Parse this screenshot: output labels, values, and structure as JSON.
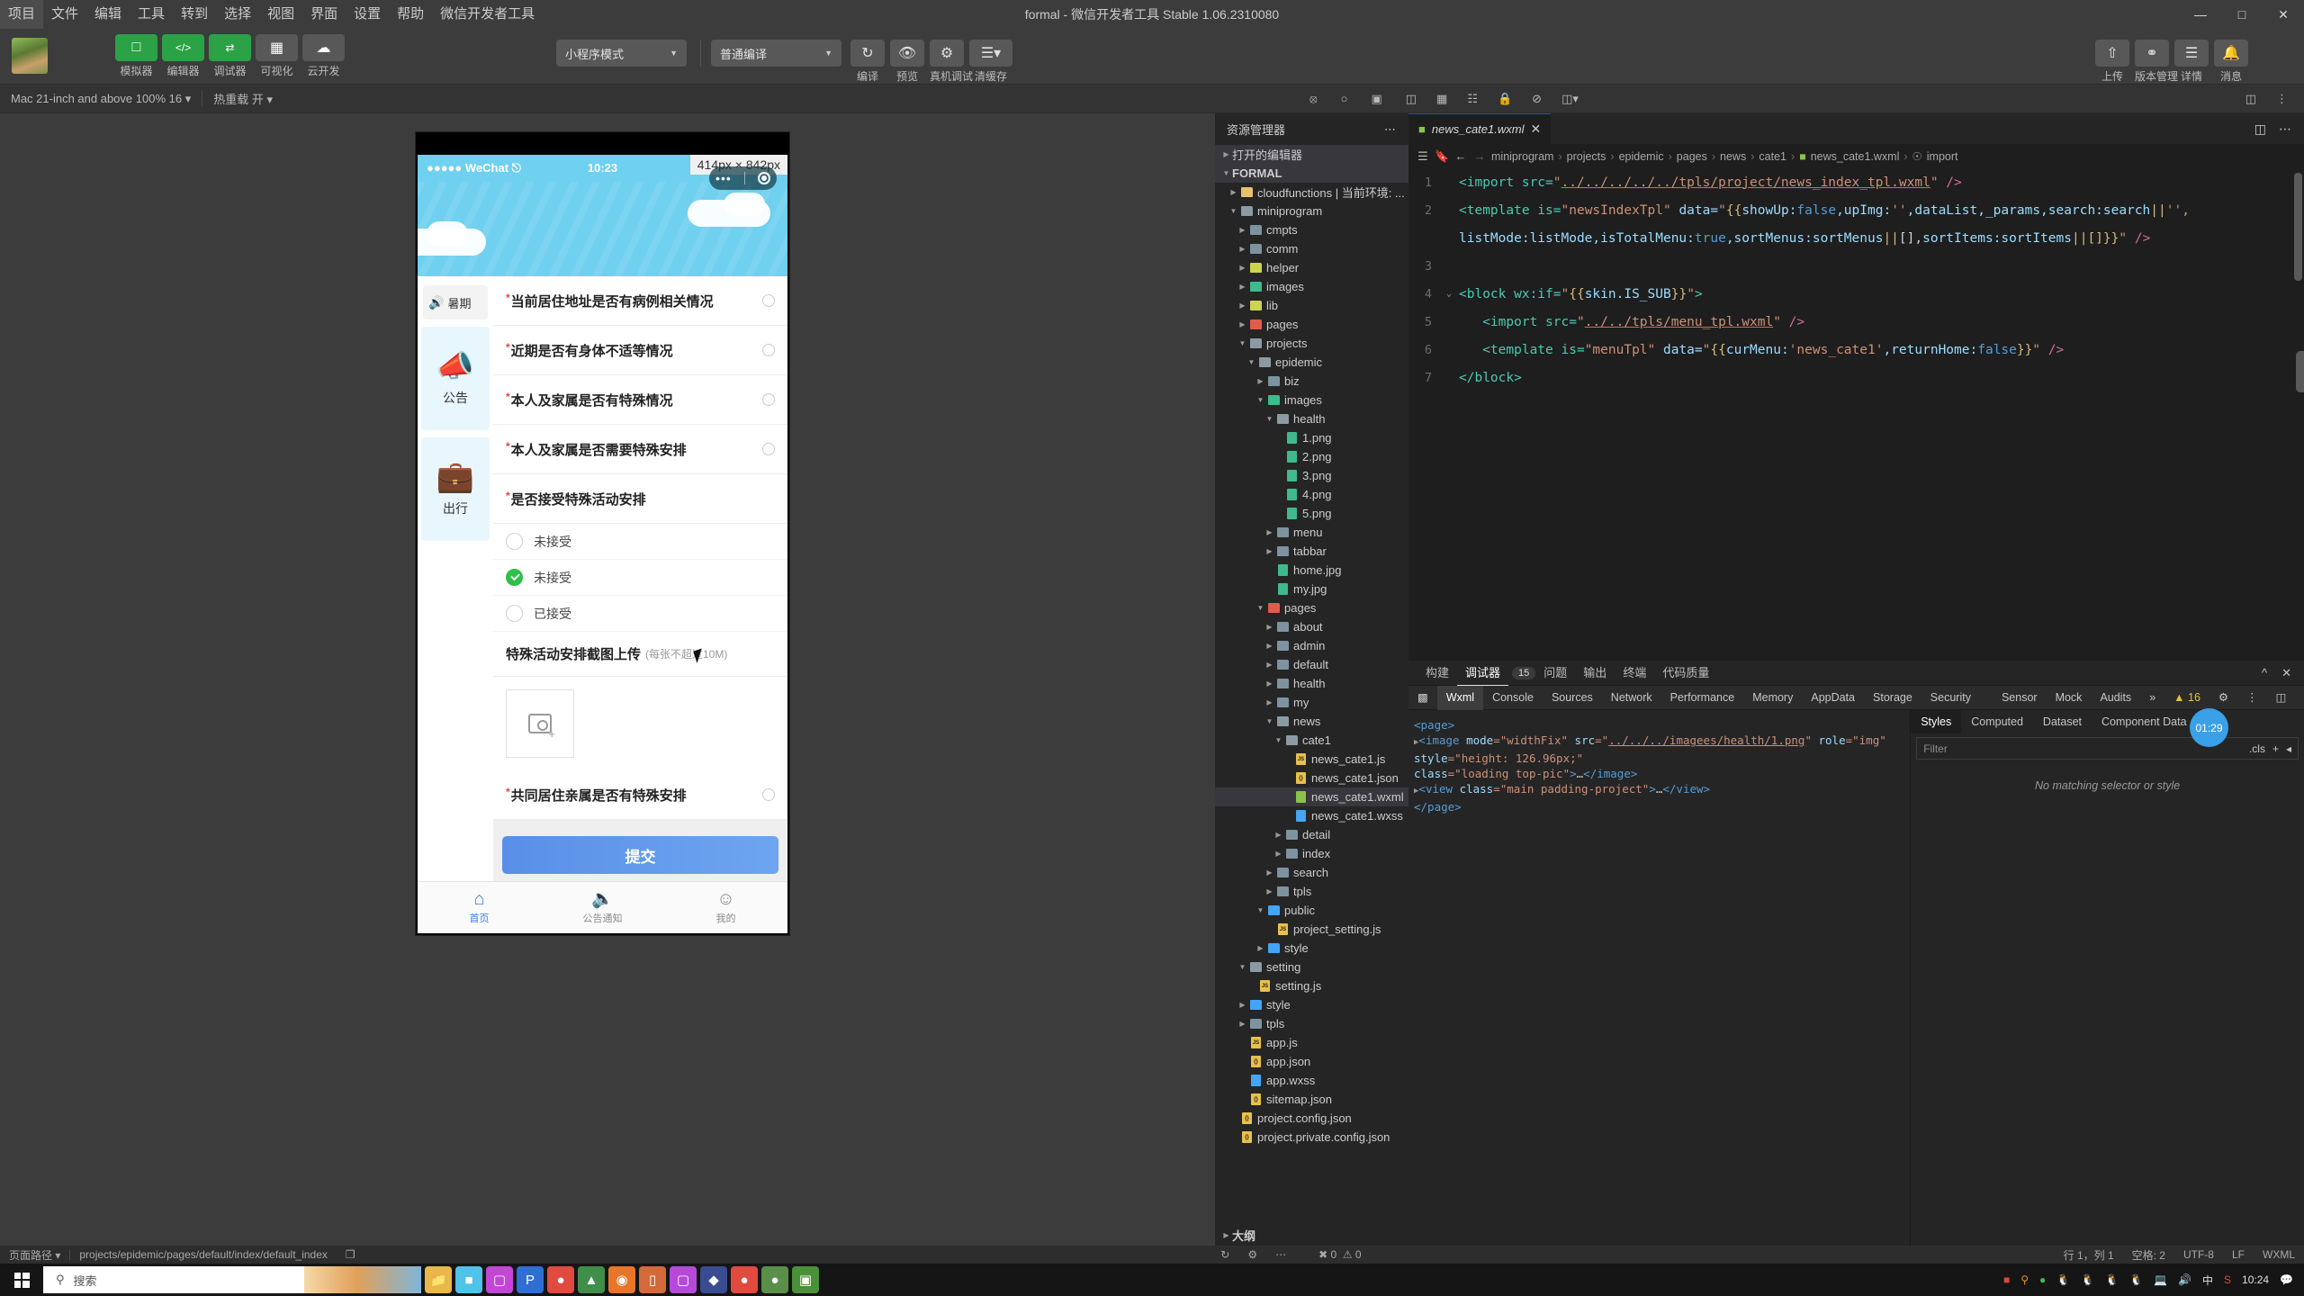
{
  "window": {
    "title": "formal - 微信开发者工具 Stable 1.06.2310080"
  },
  "menubar": {
    "items": [
      "项目",
      "文件",
      "编辑",
      "工具",
      "转到",
      "选择",
      "视图",
      "界面",
      "设置",
      "帮助",
      "微信开发者工具"
    ]
  },
  "toolbar": {
    "mode_buttons": [
      {
        "label": "模拟器",
        "icon": "phone-icon",
        "style": "green"
      },
      {
        "label": "编辑器",
        "icon": "code-icon",
        "style": "green"
      },
      {
        "label": "调试器",
        "icon": "debug-icon",
        "style": "green"
      },
      {
        "label": "可视化",
        "icon": "layout-icon",
        "style": "grey"
      },
      {
        "label": "云开发",
        "icon": "cloud-icon",
        "style": "grey"
      }
    ],
    "mode_select": "小程序模式",
    "compile_select": "普通编译",
    "actions": [
      {
        "label": "编译",
        "icon": "refresh-icon"
      },
      {
        "label": "预览",
        "icon": "eye-icon"
      },
      {
        "label": "真机调试",
        "icon": "bug-icon"
      },
      {
        "label": "清缓存",
        "icon": "layers-icon"
      }
    ],
    "right_actions": [
      {
        "label": "上传",
        "icon": "upload-icon"
      },
      {
        "label": "版本管理",
        "icon": "branch-icon"
      },
      {
        "label": "详情",
        "icon": "menu-icon"
      },
      {
        "label": "消息",
        "icon": "bell-icon"
      }
    ]
  },
  "subbar": {
    "device": "Mac 21-inch and above 100% 16",
    "hotreload": "热重载 开"
  },
  "simulator": {
    "status": {
      "carrier": "WeChat",
      "signal_dots": "●●●●●",
      "wifi": "⇡",
      "time": "10:23"
    },
    "size_chip": "414px × 842px",
    "notice": "暑期",
    "left_cards": [
      {
        "icon": "megaphone-icon",
        "label": "公告"
      },
      {
        "icon": "suitcase-icon",
        "label": "出行"
      }
    ],
    "form_rows": [
      {
        "required": true,
        "label": "当前居住地址是否有病例相关情况"
      },
      {
        "required": true,
        "label": "近期是否有身体不适等情况"
      },
      {
        "required": true,
        "label": "本人及家属是否有特殊情况"
      },
      {
        "required": true,
        "label": "本人及家属是否需要特殊安排"
      },
      {
        "required": true,
        "label": "是否接受特殊活动安排"
      }
    ],
    "options": [
      {
        "label": "未接受",
        "selected": false
      },
      {
        "label": "未接受",
        "selected": true
      },
      {
        "label": "已接受",
        "selected": false
      }
    ],
    "upload": {
      "title": "特殊活动安排截图上传",
      "hint": "(每张不超过10M)",
      "icon": "camera-add-icon"
    },
    "last_row": {
      "required": true,
      "label": "共同居住亲属是否有特殊安排"
    },
    "submit": "提交",
    "tabbar": [
      {
        "label": "首页",
        "icon": "home-icon",
        "active": true
      },
      {
        "label": "公告通知",
        "icon": "speaker-icon",
        "active": false
      },
      {
        "label": "我的",
        "icon": "face-icon",
        "active": false
      }
    ]
  },
  "explorer": {
    "title": "资源管理器",
    "open_editors": "打开的编辑器",
    "root": "FORMAL",
    "tree": [
      {
        "label": "cloudfunctions | 当前环境: ...",
        "indent": 1,
        "type": "folder",
        "color": "#e8c170",
        "arrow": "right"
      },
      {
        "label": "miniprogram",
        "indent": 1,
        "type": "folder",
        "color": "#8a9ba3",
        "arrow": "down"
      },
      {
        "label": "cmpts",
        "indent": 2,
        "type": "folder",
        "color": "#7e93a0",
        "arrow": "right"
      },
      {
        "label": "comm",
        "indent": 2,
        "type": "folder",
        "color": "#7e93a0",
        "arrow": "right"
      },
      {
        "label": "helper",
        "indent": 2,
        "type": "folder",
        "color": "#cdd44f",
        "arrow": "right"
      },
      {
        "label": "images",
        "indent": 2,
        "type": "folder",
        "color": "#3fba8c",
        "arrow": "right"
      },
      {
        "label": "lib",
        "indent": 2,
        "type": "folder",
        "color": "#cdd44f",
        "arrow": "right"
      },
      {
        "label": "pages",
        "indent": 2,
        "type": "folder",
        "color": "#e05c4a",
        "arrow": "right"
      },
      {
        "label": "projects",
        "indent": 2,
        "type": "folder",
        "color": "#8a9ba3",
        "arrow": "down"
      },
      {
        "label": "epidemic",
        "indent": 3,
        "type": "folder",
        "color": "#8a9ba3",
        "arrow": "down"
      },
      {
        "label": "biz",
        "indent": 4,
        "type": "folder",
        "color": "#7e93a0",
        "arrow": "right"
      },
      {
        "label": "images",
        "indent": 4,
        "type": "folder",
        "color": "#3fba8c",
        "arrow": "down"
      },
      {
        "label": "health",
        "indent": 5,
        "type": "folder",
        "color": "#8a9ba3",
        "arrow": "down"
      },
      {
        "label": "1.png",
        "indent": 6,
        "type": "png",
        "color": "#3fba8c",
        "arrow": ""
      },
      {
        "label": "2.png",
        "indent": 6,
        "type": "png",
        "color": "#3fba8c",
        "arrow": ""
      },
      {
        "label": "3.png",
        "indent": 6,
        "type": "png",
        "color": "#3fba8c",
        "arrow": ""
      },
      {
        "label": "4.png",
        "indent": 6,
        "type": "png",
        "color": "#3fba8c",
        "arrow": ""
      },
      {
        "label": "5.png",
        "indent": 6,
        "type": "png",
        "color": "#3fba8c",
        "arrow": ""
      },
      {
        "label": "menu",
        "indent": 5,
        "type": "folder",
        "color": "#7e93a0",
        "arrow": "right"
      },
      {
        "label": "tabbar",
        "indent": 5,
        "type": "folder",
        "color": "#7e93a0",
        "arrow": "right"
      },
      {
        "label": "home.jpg",
        "indent": 5,
        "type": "png",
        "color": "#3fba8c",
        "arrow": ""
      },
      {
        "label": "my.jpg",
        "indent": 5,
        "type": "png",
        "color": "#3fba8c",
        "arrow": ""
      },
      {
        "label": "pages",
        "indent": 4,
        "type": "folder",
        "color": "#e05c4a",
        "arrow": "down"
      },
      {
        "label": "about",
        "indent": 5,
        "type": "folder",
        "color": "#7e93a0",
        "arrow": "right"
      },
      {
        "label": "admin",
        "indent": 5,
        "type": "folder",
        "color": "#7e93a0",
        "arrow": "right"
      },
      {
        "label": "default",
        "indent": 5,
        "type": "folder",
        "color": "#7e93a0",
        "arrow": "right"
      },
      {
        "label": "health",
        "indent": 5,
        "type": "folder",
        "color": "#7e93a0",
        "arrow": "right"
      },
      {
        "label": "my",
        "indent": 5,
        "type": "folder",
        "color": "#7e93a0",
        "arrow": "right"
      },
      {
        "label": "news",
        "indent": 5,
        "type": "folder",
        "color": "#8a9ba3",
        "arrow": "down"
      },
      {
        "label": "cate1",
        "indent": 6,
        "type": "folder",
        "color": "#8a9ba3",
        "arrow": "down"
      },
      {
        "label": "news_cate1.js",
        "indent": 7,
        "type": "js",
        "color": "#e8c04b",
        "arrow": ""
      },
      {
        "label": "news_cate1.json",
        "indent": 7,
        "type": "json",
        "color": "#e8c04b",
        "arrow": ""
      },
      {
        "label": "news_cate1.wxml",
        "indent": 7,
        "type": "wxml",
        "color": "#8bc34a",
        "arrow": "",
        "selected": true
      },
      {
        "label": "news_cate1.wxss",
        "indent": 7,
        "type": "wxss",
        "color": "#42a5f5",
        "arrow": ""
      },
      {
        "label": "detail",
        "indent": 6,
        "type": "folder",
        "color": "#7e93a0",
        "arrow": "right"
      },
      {
        "label": "index",
        "indent": 6,
        "type": "folder",
        "color": "#7e93a0",
        "arrow": "right"
      },
      {
        "label": "search",
        "indent": 5,
        "type": "folder",
        "color": "#7e93a0",
        "arrow": "right"
      },
      {
        "label": "tpls",
        "indent": 5,
        "type": "folder",
        "color": "#7e93a0",
        "arrow": "right"
      },
      {
        "label": "public",
        "indent": 4,
        "type": "folder",
        "color": "#42a5f5",
        "arrow": "down"
      },
      {
        "label": "project_setting.js",
        "indent": 5,
        "type": "js",
        "color": "#e8c04b",
        "arrow": ""
      },
      {
        "label": "style",
        "indent": 4,
        "type": "folder",
        "color": "#42a5f5",
        "arrow": "right"
      },
      {
        "label": "setting",
        "indent": 2,
        "type": "folder",
        "color": "#8a9ba3",
        "arrow": "down"
      },
      {
        "label": "setting.js",
        "indent": 3,
        "type": "js",
        "color": "#e8c04b",
        "arrow": ""
      },
      {
        "label": "style",
        "indent": 2,
        "type": "folder",
        "color": "#42a5f5",
        "arrow": "right"
      },
      {
        "label": "tpls",
        "indent": 2,
        "type": "folder",
        "color": "#7e93a0",
        "arrow": "right"
      },
      {
        "label": "app.js",
        "indent": 2,
        "type": "js",
        "color": "#e8c04b",
        "arrow": ""
      },
      {
        "label": "app.json",
        "indent": 2,
        "type": "json",
        "color": "#e8c04b",
        "arrow": ""
      },
      {
        "label": "app.wxss",
        "indent": 2,
        "type": "wxss",
        "color": "#42a5f5",
        "arrow": ""
      },
      {
        "label": "sitemap.json",
        "indent": 2,
        "type": "json",
        "color": "#e8c04b",
        "arrow": ""
      },
      {
        "label": "project.config.json",
        "indent": 1,
        "type": "json",
        "color": "#e8c04b",
        "arrow": ""
      },
      {
        "label": "project.private.config.json",
        "indent": 1,
        "type": "json",
        "color": "#e8c04b",
        "arrow": ""
      }
    ],
    "outline": "大纲"
  },
  "editor": {
    "tab": {
      "name": "news_cate1.wxml",
      "close": "✕"
    },
    "breadcrumb": [
      "miniprogram",
      "projects",
      "epidemic",
      "pages",
      "news",
      "cate1",
      "news_cate1.wxml",
      "import"
    ],
    "lines": [
      {
        "n": "1",
        "segments": [
          {
            "t": "<import src=",
            "c": "t-tag"
          },
          {
            "t": "\"",
            "c": "t-str"
          },
          {
            "t": "../../../../../tpls/project/news_index_tpl.wxml",
            "c": "t-link"
          },
          {
            "t": "\"",
            "c": "t-str"
          },
          {
            "t": " />",
            "c": "t-pink"
          }
        ]
      },
      {
        "n": "2",
        "segments": [
          {
            "t": "<template is=",
            "c": "t-tag"
          },
          {
            "t": "\"newsIndexTpl\"",
            "c": "t-str"
          },
          {
            "t": " data=",
            "c": "t-attr"
          },
          {
            "t": "\"",
            "c": "t-str"
          },
          {
            "t": "{{",
            "c": "t-brace"
          },
          {
            "t": "showUp:",
            "c": "t-var"
          },
          {
            "t": "false",
            "c": "t-bool"
          },
          {
            "t": ",upImg:",
            "c": "t-var"
          },
          {
            "t": "''",
            "c": "t-str"
          },
          {
            "t": ",dataList,_params,search:search",
            "c": "t-var"
          },
          {
            "t": "||",
            "c": "t-brace"
          },
          {
            "t": "'',",
            "c": "t-str"
          }
        ]
      },
      {
        "n": "",
        "segments": [
          {
            "t": "listMode:listMode,isTotalMenu:",
            "c": "t-var"
          },
          {
            "t": "true",
            "c": "t-bool"
          },
          {
            "t": ",sortMenus:sortMenus",
            "c": "t-var"
          },
          {
            "t": "||",
            "c": "t-brace"
          },
          {
            "t": "[],",
            "c": "t-op"
          },
          {
            "t": "sortItems:sortItems",
            "c": "t-var"
          },
          {
            "t": "||",
            "c": "t-brace"
          },
          {
            "t": "[]}}",
            "c": "t-brace"
          },
          {
            "t": "\"",
            "c": "t-str"
          },
          {
            "t": " />",
            "c": "t-pink"
          }
        ]
      },
      {
        "n": "3",
        "segments": []
      },
      {
        "n": "4",
        "segments": [
          {
            "t": "<block wx:if=",
            "c": "t-tag"
          },
          {
            "t": "\"",
            "c": "t-str"
          },
          {
            "t": "{{",
            "c": "t-brace"
          },
          {
            "t": "skin.IS_SUB",
            "c": "t-var"
          },
          {
            "t": "}}",
            "c": "t-brace"
          },
          {
            "t": "\"",
            "c": "t-str"
          },
          {
            "t": ">",
            "c": "t-tag"
          }
        ]
      },
      {
        "n": "5",
        "segments": [
          {
            "t": "   <import src=",
            "c": "t-tag"
          },
          {
            "t": "\"",
            "c": "t-str"
          },
          {
            "t": "../../tpls/menu_tpl.wxml",
            "c": "t-link"
          },
          {
            "t": "\"",
            "c": "t-str"
          },
          {
            "t": " />",
            "c": "t-pink"
          }
        ]
      },
      {
        "n": "6",
        "segments": [
          {
            "t": "   <template is=",
            "c": "t-tag"
          },
          {
            "t": "\"menuTpl\"",
            "c": "t-str"
          },
          {
            "t": " data=",
            "c": "t-attr"
          },
          {
            "t": "\"",
            "c": "t-str"
          },
          {
            "t": "{{",
            "c": "t-brace"
          },
          {
            "t": "curMenu:",
            "c": "t-var"
          },
          {
            "t": "'news_cate1'",
            "c": "t-str"
          },
          {
            "t": ",returnHome:",
            "c": "t-var"
          },
          {
            "t": "false",
            "c": "t-bool"
          },
          {
            "t": "}}",
            "c": "t-brace"
          },
          {
            "t": "\"",
            "c": "t-str"
          },
          {
            "t": " />",
            "c": "t-pink"
          }
        ]
      },
      {
        "n": "7",
        "segments": [
          {
            "t": "</block>",
            "c": "t-tag"
          }
        ]
      }
    ]
  },
  "devtools": {
    "panel_tabs": [
      {
        "label": "构建",
        "active": false
      },
      {
        "label": "调试器",
        "active": true,
        "badge": "15"
      },
      {
        "label": "问题",
        "active": false
      },
      {
        "label": "输出",
        "active": false
      },
      {
        "label": "终端",
        "active": false
      },
      {
        "label": "代码质量",
        "active": false
      }
    ],
    "inspector_tabs": [
      "Wxml",
      "Console",
      "Sources",
      "Network",
      "Performance",
      "Memory",
      "AppData",
      "Storage",
      "Security",
      "Sensor",
      "Mock",
      "Audits"
    ],
    "inspector_active": "Wxml",
    "more": "»",
    "warn_count": "16",
    "wxml_lines": [
      "<page>",
      "<image mode=\"widthFix\" src=\"../../../imagees/health/1.png\" role=\"img\" style=\"height: 126.96px;\"",
      "class=\"loading top-pic\">…</image>",
      "<view class=\"main padding-project\">…</view>",
      "</page>"
    ],
    "styles_tabs": [
      "Styles",
      "Computed",
      "Dataset",
      "Component Data"
    ],
    "styles_active": "Styles",
    "filter_placeholder": "Filter",
    "cls_label": ".cls",
    "no_match": "No matching selector or style"
  },
  "statusbar": {
    "page_path_label": "页面路径",
    "page_path": "projects/epidemic/pages/default/index/default_index",
    "errors": "0",
    "warnings": "0",
    "cursor": "行 1，列 1",
    "indent": "空格: 2",
    "encoding": "UTF-8",
    "eol": "LF",
    "language": "WXML"
  },
  "taskbar": {
    "search_placeholder": "搜索",
    "ime": "中",
    "clock": "10:24"
  },
  "fab": {
    "label": "01:29"
  },
  "colors": {
    "accent_green": "#2ba245",
    "editor_bg": "#1e1e1e",
    "panel_bg": "#252526",
    "chrome": "#3c3c3c"
  }
}
